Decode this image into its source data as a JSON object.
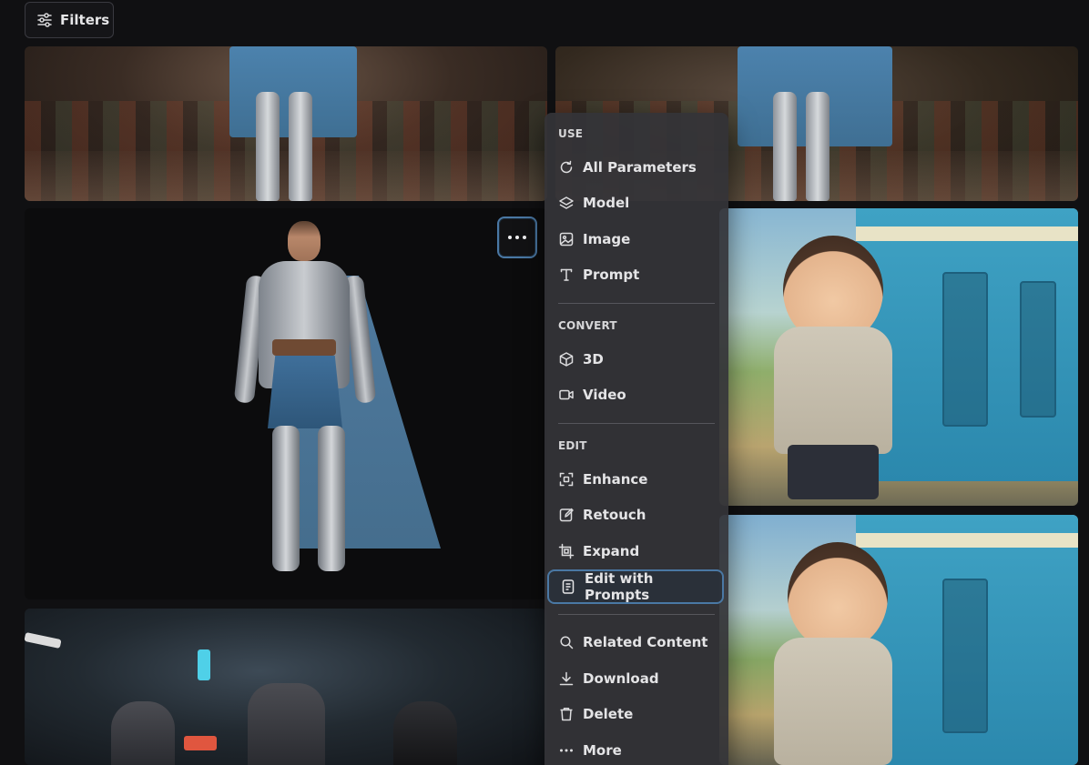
{
  "toolbar": {
    "filters_label": "Filters",
    "filters_icon": "sliders-icon"
  },
  "gallery": {
    "images": [
      {
        "name": "knight-ballroom-left"
      },
      {
        "name": "knight-ballroom-right"
      },
      {
        "name": "armored-knight-portrait"
      },
      {
        "name": "anime-boy-train-1"
      },
      {
        "name": "anime-boy-train-2"
      },
      {
        "name": "cyberpunk-soldiers"
      }
    ],
    "more_button_icon": "ellipsis-icon"
  },
  "context_menu": {
    "sections": [
      {
        "heading": "USE",
        "items": [
          {
            "label": "All Parameters",
            "icon": "refresh-icon"
          },
          {
            "label": "Model",
            "icon": "layers-icon"
          },
          {
            "label": "Image",
            "icon": "image-icon"
          },
          {
            "label": "Prompt",
            "icon": "text-icon"
          }
        ]
      },
      {
        "heading": "CONVERT",
        "items": [
          {
            "label": "3D",
            "icon": "cube-icon"
          },
          {
            "label": "Video",
            "icon": "video-icon"
          }
        ]
      },
      {
        "heading": "EDIT",
        "items": [
          {
            "label": "Enhance",
            "icon": "enhance-icon"
          },
          {
            "label": "Retouch",
            "icon": "edit-icon"
          },
          {
            "label": "Expand",
            "icon": "crop-icon"
          },
          {
            "label": "Edit with Prompts",
            "icon": "document-icon",
            "highlighted": true
          }
        ]
      },
      {
        "heading": "",
        "items": [
          {
            "label": "Related Content",
            "icon": "search-icon"
          },
          {
            "label": "Download",
            "icon": "download-icon"
          },
          {
            "label": "Delete",
            "icon": "trash-icon"
          },
          {
            "label": "More",
            "icon": "ellipsis-icon"
          }
        ]
      }
    ]
  },
  "colors": {
    "background": "#101012",
    "menu_background": "#343438",
    "focus_ring": "#4a78a4"
  }
}
